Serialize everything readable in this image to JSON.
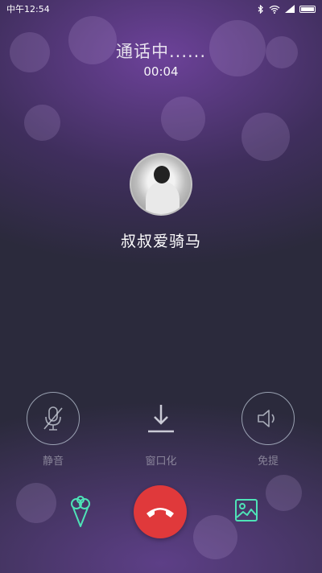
{
  "status_bar": {
    "time": "中午12:54",
    "icons": [
      "bluetooth-icon",
      "wifi-icon",
      "signal-icon",
      "battery-icon"
    ]
  },
  "call": {
    "status": "通话中......",
    "timer": "00:04",
    "contact_name": "叔叔爱骑马"
  },
  "controls": {
    "mute_label": "静音",
    "minimize_label": "窗口化",
    "speaker_label": "免提"
  },
  "bottom": {
    "left_icon": "ice-cream-icon",
    "center_icon": "end-call-icon",
    "right_icon": "gallery-icon",
    "end_call_color": "#e0393b",
    "accent_color": "#4ee3b7"
  }
}
